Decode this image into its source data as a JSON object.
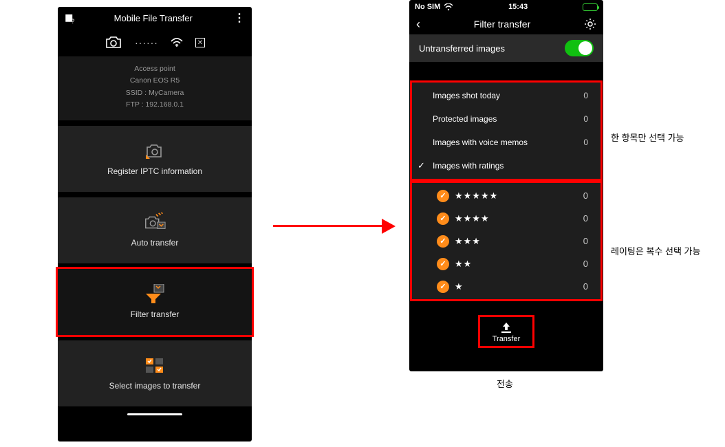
{
  "left": {
    "title": "Mobile File Transfer",
    "conn_dots": "······",
    "access_point": "Access point",
    "camera_model": "Canon EOS R5",
    "ssid": "SSID : MyCamera",
    "ftp": "FTP : 192.168.0.1",
    "menu": {
      "iptc": "Register IPTC information",
      "auto": "Auto transfer",
      "filter": "Filter transfer",
      "select": "Select images to transfer"
    }
  },
  "right": {
    "status": {
      "sim": "No SIM",
      "time": "15:43"
    },
    "title": "Filter transfer",
    "untransferred": "Untransferred images",
    "filters": {
      "today": {
        "label": "Images shot today",
        "count": "0"
      },
      "protected": {
        "label": "Protected images",
        "count": "0"
      },
      "voice": {
        "label": "Images with voice memos",
        "count": "0"
      },
      "ratings": {
        "label": "Images with ratings"
      }
    },
    "ratings": [
      {
        "stars": "★★★★★",
        "count": "0"
      },
      {
        "stars": "★★★★",
        "count": "0"
      },
      {
        "stars": "★★★",
        "count": "0"
      },
      {
        "stars": "★★",
        "count": "0"
      },
      {
        "stars": "★",
        "count": "0"
      }
    ],
    "transfer": "Transfer"
  },
  "annotations": {
    "single_select": "한 항목만 선택 가능",
    "multi_select": "레이팅은 복수 선택 가능",
    "send": "전송"
  }
}
